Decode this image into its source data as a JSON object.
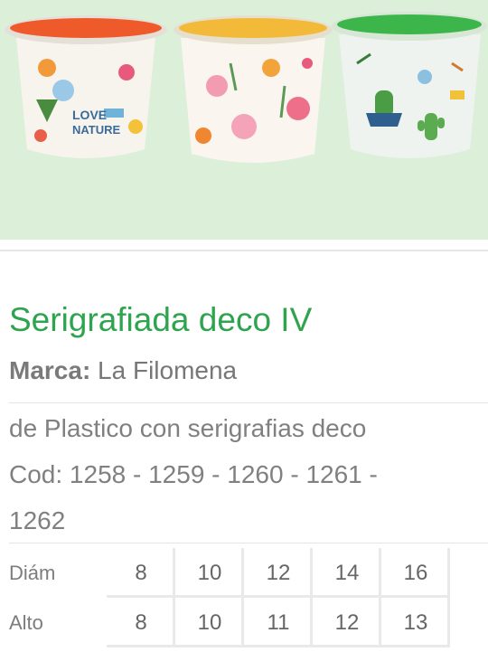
{
  "product": {
    "image_alt": "Macetas de plástico serigrafiadas",
    "title": "Serigrafiada deco IV",
    "brand_label": "Marca:",
    "brand_value": "La Filomena",
    "description_line1": "de Plastico con serigrafias deco",
    "description_line2": "Cod: 1258 - 1259 - 1260 - 1261 -",
    "description_line3": "1262"
  },
  "dimensions": {
    "rows": [
      {
        "label": "Diám",
        "values": [
          "8",
          "10",
          "12",
          "14",
          "16"
        ]
      },
      {
        "label": "Alto",
        "values": [
          "8",
          "10",
          "11",
          "12",
          "13"
        ]
      }
    ]
  },
  "colors": {
    "hero_background": "#dcefd9",
    "title_green": "#2ea44f",
    "pot_rim_orange": "#ef5a2b",
    "pot_rim_yellow": "#f3b938",
    "pot_rim_green": "#3cb64a"
  },
  "icons": {
    "pot1": "pot-love-nature-icon",
    "pot2": "pot-flowers-icon",
    "pot3": "pot-cactus-icon"
  }
}
